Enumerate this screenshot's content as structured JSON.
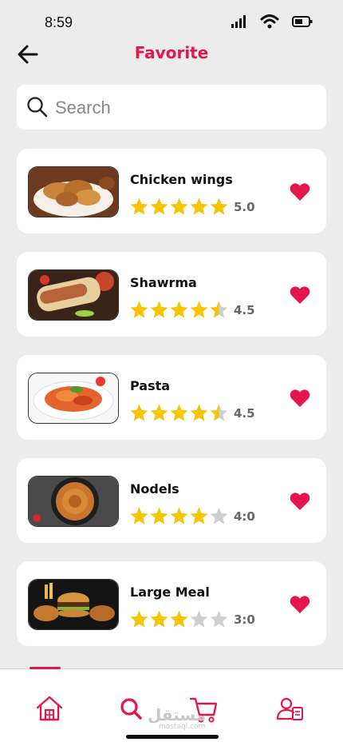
{
  "status_bar": {
    "time": "8:59"
  },
  "header": {
    "title": "Favorite"
  },
  "search": {
    "placeholder": "Search"
  },
  "colors": {
    "accent": "#e3164d",
    "star": "#f7c400",
    "star_empty": "#cfcfcf",
    "background": "#ececec"
  },
  "favorites": [
    {
      "name": "Chicken wings",
      "rating": 5.0,
      "rating_label": "5.0"
    },
    {
      "name": "Shawrma",
      "rating": 4.5,
      "rating_label": "4.5"
    },
    {
      "name": "Pasta",
      "rating": 4.5,
      "rating_label": "4.5"
    },
    {
      "name": "Nodels",
      "rating": 4.0,
      "rating_label": "4:0"
    },
    {
      "name": "Large Meal",
      "rating": 3.0,
      "rating_label": "3:0"
    }
  ],
  "bottom_nav": {
    "active": "search",
    "items": [
      "home-icon",
      "search-icon",
      "cart-icon",
      "profile-icon"
    ]
  },
  "watermark": {
    "arabic": "مستقل",
    "latin": "mostaql.com"
  }
}
